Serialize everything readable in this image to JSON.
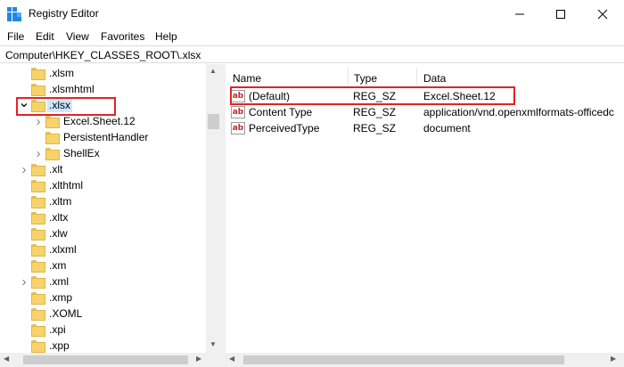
{
  "window": {
    "title": "Registry Editor"
  },
  "menu": [
    "File",
    "Edit",
    "View",
    "Favorites",
    "Help"
  ],
  "address": "Computer\\HKEY_CLASSES_ROOT\\.xlsx",
  "tree": [
    {
      "label": ".xlsm",
      "expander": ""
    },
    {
      "label": ".xlsmhtml",
      "expander": ""
    },
    {
      "label": ".xlsx",
      "expander": "open",
      "selected": true
    },
    {
      "label": "Excel.Sheet.12",
      "expander": "closed",
      "child": true
    },
    {
      "label": "PersistentHandler",
      "expander": "",
      "child": true
    },
    {
      "label": "ShellEx",
      "expander": "closed",
      "child": true
    },
    {
      "label": ".xlt",
      "expander": "closed"
    },
    {
      "label": ".xlthtml",
      "expander": ""
    },
    {
      "label": ".xltm",
      "expander": ""
    },
    {
      "label": ".xltx",
      "expander": ""
    },
    {
      "label": ".xlw",
      "expander": ""
    },
    {
      "label": ".xlxml",
      "expander": ""
    },
    {
      "label": ".xm",
      "expander": ""
    },
    {
      "label": ".xml",
      "expander": "closed"
    },
    {
      "label": ".xmp",
      "expander": ""
    },
    {
      "label": ".XOML",
      "expander": ""
    },
    {
      "label": ".xpi",
      "expander": ""
    },
    {
      "label": ".xpp",
      "expander": ""
    }
  ],
  "columns": {
    "name": "Name",
    "type": "Type",
    "data": "Data"
  },
  "values": [
    {
      "name": "(Default)",
      "type": "REG_SZ",
      "data": "Excel.Sheet.12"
    },
    {
      "name": "Content Type",
      "type": "REG_SZ",
      "data": "application/vnd.openxmlformats-officedc"
    },
    {
      "name": "PerceivedType",
      "type": "REG_SZ",
      "data": "document"
    }
  ],
  "icons": {
    "value_icon": "string-value-icon",
    "folder_icon": "folder-icon"
  },
  "colors": {
    "highlight": "#e02424",
    "selection": "#cce8ff"
  }
}
